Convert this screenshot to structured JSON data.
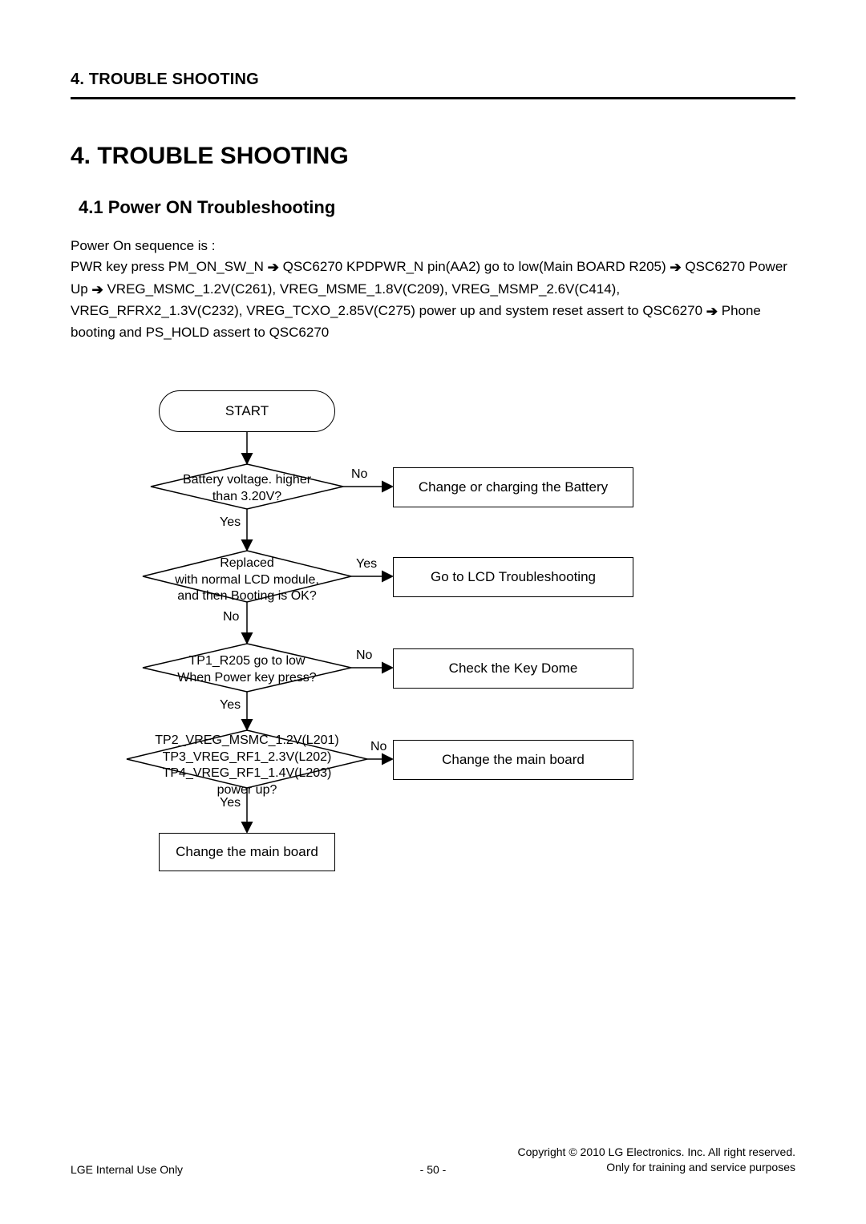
{
  "header": {
    "running_title": "4. TROUBLE SHOOTING"
  },
  "title": "4. TROUBLE SHOOTING",
  "subtitle": "4.1  Power ON Troubleshooting",
  "body": {
    "intro": "Power On sequence is :",
    "seq1a": "PWR key press PM_ON_SW_N ",
    "seq1b": " QSC6270 KPDPWR_N pin(AA2) go to low(Main BOARD R205) ",
    "seq1c": " QSC6270 Power Up ",
    "seq1d": " VREG_MSMC_1.2V(C261), VREG_MSME_1.8V(C209), VREG_MSMP_2.6V(C414), VREG_RFRX2_1.3V(C232), VREG_TCXO_2.85V(C275) power up and system reset assert to QSC6270 ",
    "seq1e": " Phone booting and PS_HOLD assert to QSC6270"
  },
  "flow": {
    "start": "START",
    "d1_l1": "Battery voltage. higher",
    "d1_l2": "than 3.20V?",
    "d2_l1": "Replaced",
    "d2_l2": "with normal LCD module,",
    "d2_l3": "and then Booting is OK?",
    "d3_l1": "TP1_R205 go to low",
    "d3_l2": "When Power key press?",
    "d4_l1": "TP2_VREG_MSMC_1.2V(L201)",
    "d4_l2": "TP3_VREG_RF1_2.3V(L202)",
    "d4_l3": "TP4_VREG_RF1_1.4V(L203)",
    "d4_l4": "power up?",
    "a1": "Change or charging the Battery",
    "a2": "Go to LCD Troubleshooting",
    "a3": "Check the Key Dome",
    "a4": "Change the main board",
    "end": "Change the main board",
    "yes": "Yes",
    "no": "No"
  },
  "footer": {
    "left": "LGE Internal Use Only",
    "center": "- 50 -",
    "right1": "Copyright © 2010 LG Electronics. Inc. All right reserved.",
    "right2": "Only for training and service purposes"
  },
  "glyphs": {
    "arrow": "➔"
  }
}
